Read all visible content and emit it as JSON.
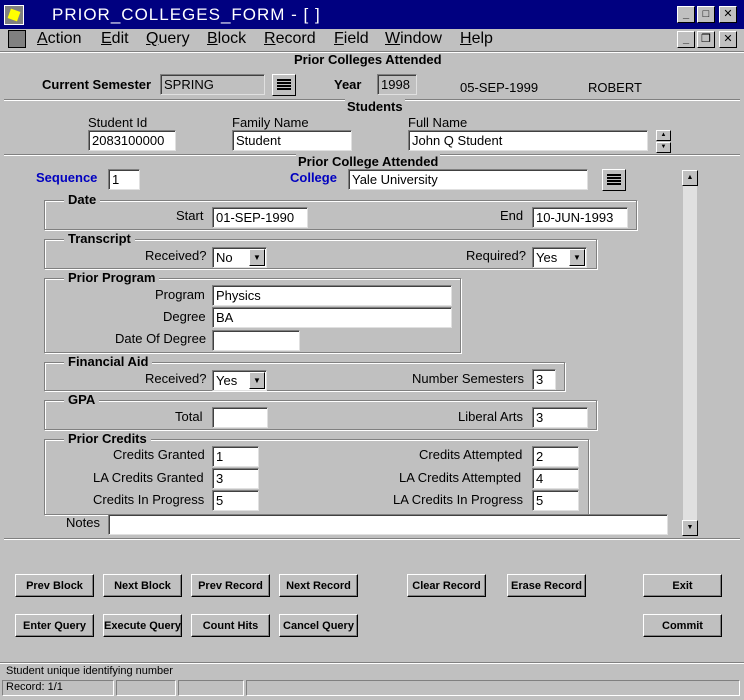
{
  "window": {
    "title": "PRIOR_COLLEGES_FORM - [ ]"
  },
  "menu": [
    "Action",
    "Edit",
    "Query",
    "Block",
    "Record",
    "Field",
    "Window",
    "Help"
  ],
  "form_title": "Prior Colleges Attended",
  "header": {
    "semester_label": "Current Semester",
    "semester_value": "SPRING",
    "year_label": "Year",
    "year_value": "1998",
    "date": "05-SEP-1999",
    "user": "ROBERT"
  },
  "students": {
    "title": "Students",
    "student_id_label": "Student Id",
    "student_id": "2083100000",
    "family_name_label": "Family Name",
    "family_name": "Student",
    "full_name_label": "Full Name",
    "full_name": "John Q Student"
  },
  "prior": {
    "title": "Prior College Attended",
    "sequence_label": "Sequence",
    "sequence": "1",
    "college_label": "College",
    "college": "Yale University",
    "date": {
      "title": "Date",
      "start_label": "Start",
      "start": "01-SEP-1990",
      "end_label": "End",
      "end": "10-JUN-1993"
    },
    "transcript": {
      "title": "Transcript",
      "received_label": "Received?",
      "received": "No",
      "required_label": "Required?",
      "required": "Yes"
    },
    "program": {
      "title": "Prior  Program",
      "program_label": "Program",
      "program": "Physics",
      "degree_label": "Degree",
      "degree": "BA",
      "date_of_degree_label": "Date Of Degree",
      "date_of_degree": ""
    },
    "financial": {
      "title": "Financial Aid",
      "received_label": "Received?",
      "received": "Yes",
      "semesters_label": "Number Semesters",
      "semesters": "3"
    },
    "gpa": {
      "title": "GPA",
      "total_label": "Total",
      "total": "",
      "liberal_label": "Liberal Arts",
      "liberal": "3"
    },
    "credits": {
      "title": "Prior Credits",
      "granted_label": "Credits Granted",
      "granted": "1",
      "attempted_label": "Credits Attempted",
      "attempted": "2",
      "la_granted_label": "LA Credits Granted",
      "la_granted": "3",
      "la_attempted_label": "LA Credits Attempted",
      "la_attempted": "4",
      "in_progress_label": "Credits In Progress",
      "in_progress": "5",
      "la_in_progress_label": "LA Credits In Progress",
      "la_in_progress": "5"
    },
    "notes_label": "Notes",
    "notes": ""
  },
  "buttons": {
    "prev_block": "Prev Block",
    "next_block": "Next Block",
    "prev_record": "Prev Record",
    "next_record": "Next Record",
    "clear_record": "Clear Record",
    "erase_record": "Erase Record",
    "exit": "Exit",
    "enter_query": "Enter Query",
    "execute_query": "Execute Query",
    "count_hits": "Count Hits",
    "cancel_query": "Cancel Query",
    "commit": "Commit"
  },
  "status": {
    "message": "Student unique identifying number",
    "record": "Record: 1/1"
  }
}
